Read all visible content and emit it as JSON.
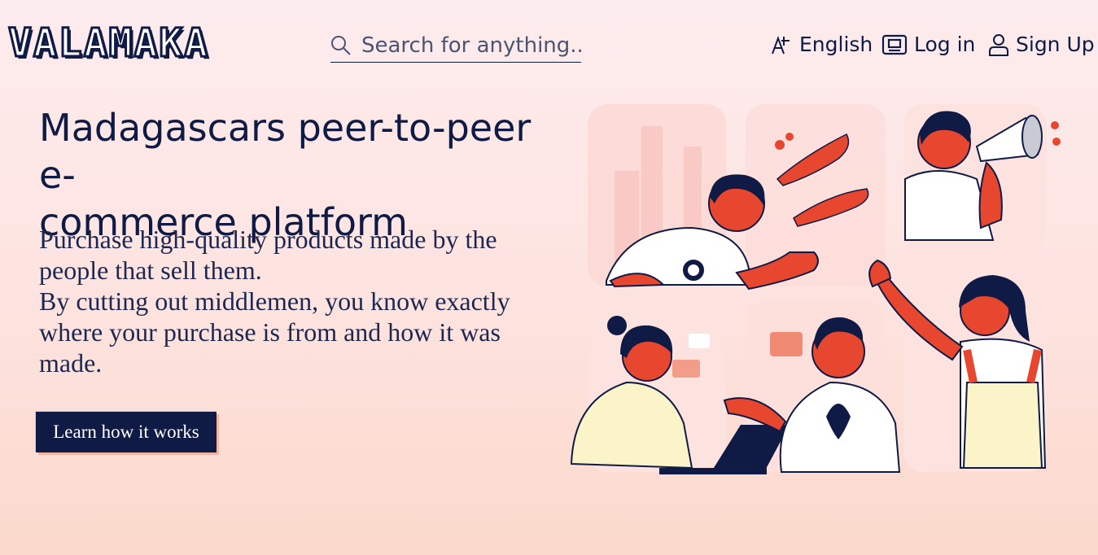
{
  "header": {
    "logo": "VALAMAKA",
    "search": {
      "placeholder": "Search for anything..."
    },
    "nav": [
      {
        "icon": "translate-icon",
        "label": "English"
      },
      {
        "icon": "login-card-icon",
        "label": "Log in"
      },
      {
        "icon": "user-icon",
        "label": "Sign Up"
      }
    ]
  },
  "hero": {
    "headline_line1": "Madagascars peer-to-peer e-",
    "headline_line2": "commerce platform",
    "desc_line1": "Purchase high-quality products made by the",
    "desc_line2": "people that sell them.",
    "desc_line3": "By cutting out middlemen, you know exactly",
    "desc_line4": "where your purchase is from and how it was",
    "desc_line5": "made.",
    "cta_label": "Learn how it works"
  },
  "colors": {
    "navy": "#0f1a45",
    "accent_red": "#e8472f",
    "cream": "#fbf4c8",
    "bg_pink": "#fde6e6"
  }
}
